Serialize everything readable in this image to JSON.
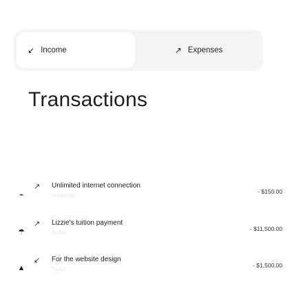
{
  "toggles": {
    "income": {
      "label": "Income",
      "icon": "arrow-down-left-icon",
      "glyph": "↙"
    },
    "expenses": {
      "label": "Expenses",
      "icon": "arrow-up-right-icon",
      "glyph": "↗"
    }
  },
  "heading": "Transactions",
  "transactions": [
    {
      "title": "Unlimited internet connection",
      "subtitle": "yesterday",
      "amount": "- $150.00",
      "direction": "↗",
      "glyph": "⌁"
    },
    {
      "title": "Lizzie's tuition payment",
      "subtitle": "Today",
      "amount": "- $11,500.00",
      "direction": "↗",
      "glyph": "☂"
    },
    {
      "title": "For the website design",
      "subtitle": "Today",
      "amount": "- $1,500.00",
      "direction": "↙",
      "glyph": "▲"
    }
  ]
}
